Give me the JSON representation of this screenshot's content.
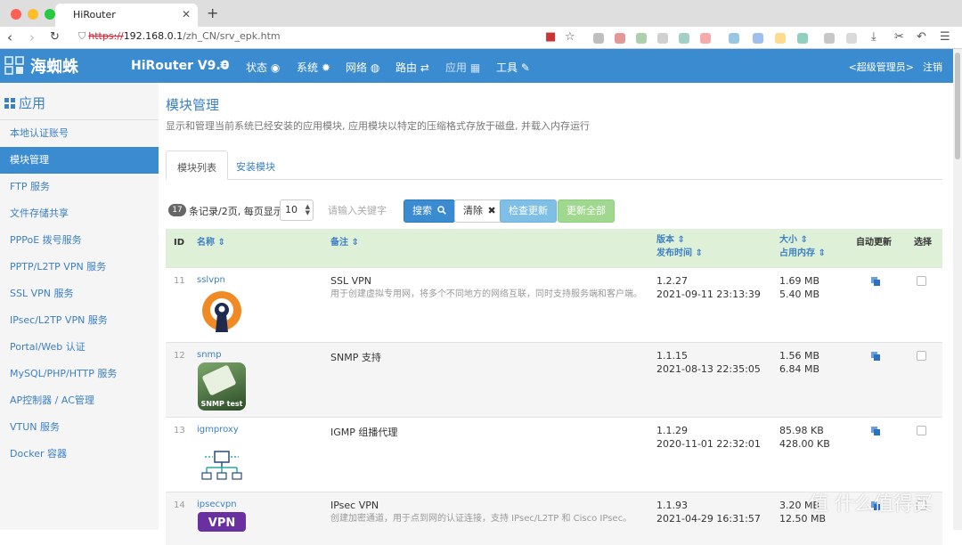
{
  "browser": {
    "tab_title": "HiRouter",
    "url_scheme": "https://",
    "url_host": "192.168.0.1",
    "url_path": "/zh_CN/srv_epk.htm"
  },
  "navbar": {
    "logo_text": "海蜘蛛",
    "brand": "HiRouter V9.0",
    "menus": [
      {
        "label": "状态 ◉"
      },
      {
        "label": "系统 ✹"
      },
      {
        "label": "网络 ◍"
      },
      {
        "label": "路由 ⇄"
      },
      {
        "label": "应用 ▦"
      },
      {
        "label": "工具 ✎"
      }
    ],
    "admin": "<超级管理员>",
    "logout": "注销"
  },
  "sidebar": {
    "heading": "应用",
    "items": [
      {
        "label": "本地认证账号"
      },
      {
        "label": "模块管理"
      },
      {
        "label": "FTP 服务"
      },
      {
        "label": "文件存储共享"
      },
      {
        "label": "PPPoE 拨号服务"
      },
      {
        "label": "PPTP/L2TP VPN 服务"
      },
      {
        "label": "SSL VPN 服务"
      },
      {
        "label": "IPsec/L2TP VPN 服务"
      },
      {
        "label": "Portal/Web 认证"
      },
      {
        "label": "MySQL/PHP/HTTP 服务"
      },
      {
        "label": "AP控制器 / AC管理"
      },
      {
        "label": "VTUN 服务"
      },
      {
        "label": "Docker 容器"
      }
    ]
  },
  "page": {
    "title": "模块管理",
    "description": "显示和管理当前系统已经安装的应用模块, 应用模块以特定的压缩格式存放于磁盘, 并载入内存运行",
    "tabs": [
      {
        "label": "模块列表"
      },
      {
        "label": "安装模块"
      }
    ]
  },
  "toolbar": {
    "record_count": "17",
    "record_text": "条记录/2页, 每页显示",
    "page_size": "10",
    "search_placeholder": "请输入关键字",
    "search_label": "搜索",
    "clear_label": "清除",
    "check_update_label": "检查更新",
    "update_all_label": "更新全部"
  },
  "table": {
    "headers": {
      "id": "ID",
      "name": "名称 ⇕",
      "note": "备注 ⇕",
      "version": "版本 ⇕",
      "release_time": "发布时间 ⇕",
      "size": "大小 ⇕",
      "memory": "占用内存 ⇕",
      "auto_update": "自动更新",
      "select": "选择"
    },
    "rows": [
      {
        "id": "11",
        "name": "sslvpn",
        "note": "SSL VPN",
        "note_desc": "用于创建虚拟专用网，将多个不同地方的网络互联，同时支持服务端和客户端。",
        "version": "1.2.27",
        "date": "2021-09-11 23:13:39",
        "size": "1.69 MB",
        "memory": "5.40 MB"
      },
      {
        "id": "12",
        "name": "snmp",
        "note": "SNMP 支持",
        "note_desc": "",
        "version": "1.1.15",
        "date": "2021-08-13 22:35:05",
        "size": "1.56 MB",
        "memory": "6.84 MB",
        "icon_text": "SNMP test"
      },
      {
        "id": "13",
        "name": "igmproxy",
        "note": "IGMP 组播代理",
        "note_desc": "",
        "version": "1.1.29",
        "date": "2020-11-01 22:32:01",
        "size": "85.98 KB",
        "memory": "428.00 KB"
      },
      {
        "id": "14",
        "name": "ipsecvpn",
        "note": "IPsec VPN",
        "note_desc": "创建加密通道，用于点到网的认证连接，支持 IPsec/L2TP 和 Cisco IPsec。",
        "version": "1.1.93",
        "date": "2021-04-29 16:31:57",
        "size": "3.20 MB",
        "memory": "12.50 MB",
        "icon_text": "VPN"
      }
    ]
  },
  "watermark": "值 什么值得买",
  "colors": {
    "accent": "#3b8bd0",
    "header_row": "#dff0d8",
    "link": "#3b7fc4"
  }
}
